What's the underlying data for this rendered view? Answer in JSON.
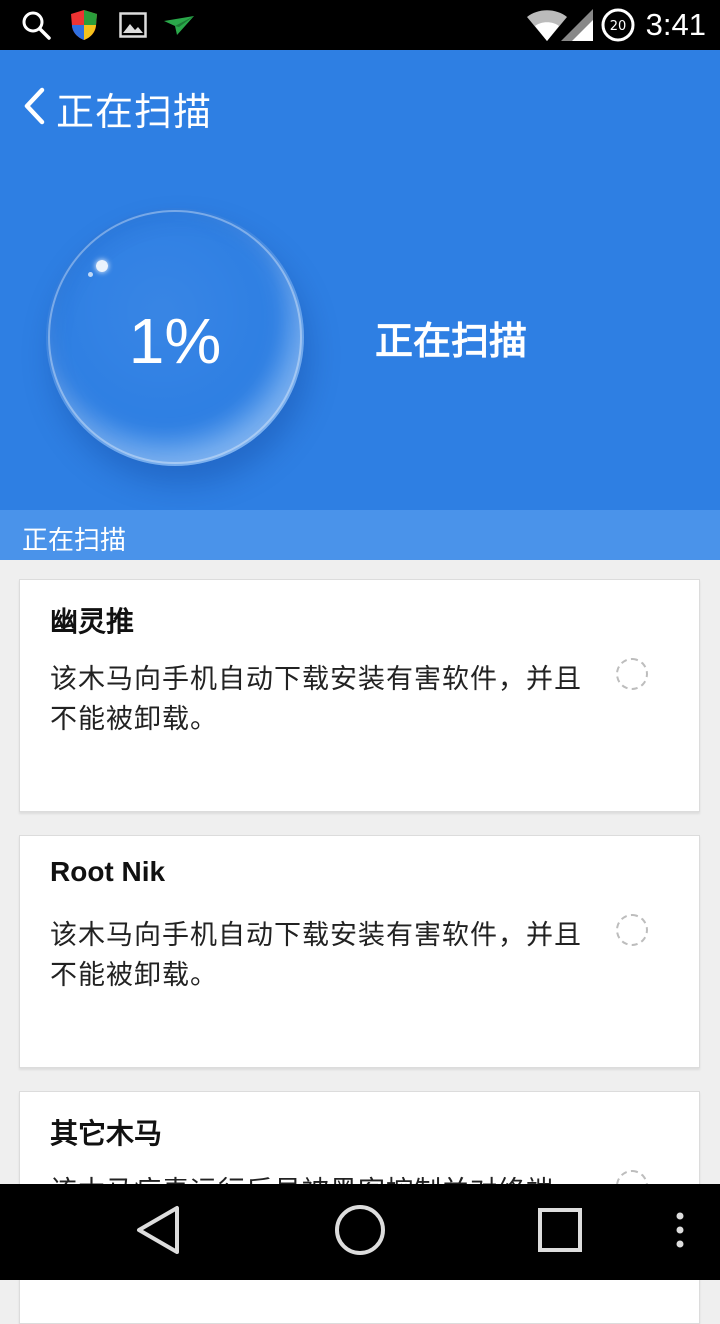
{
  "status_bar": {
    "time": "3:41",
    "notification_count": "20",
    "icons": [
      "search-icon",
      "shield-icon",
      "image-icon",
      "plane-icon",
      "wifi-icon",
      "signal-icon",
      "battery-icon"
    ]
  },
  "header": {
    "back_title": "正在扫描",
    "progress_text": "1%",
    "progress_percent": 1,
    "status_text": "正在扫描",
    "background_color": "#2e7fe3"
  },
  "sub_bar": {
    "label": "正在扫描"
  },
  "cards": [
    {
      "title": "幽灵推",
      "description": "该木马向手机自动下载安装有害软件，并且不能被卸载。"
    },
    {
      "title": "Root Nik",
      "description": "该木马向手机自动下载安装有害软件，并且不能被卸载。"
    },
    {
      "title": "其它木马",
      "description": "该木马病毒运行后易被黑客控制并对终端"
    }
  ],
  "nav_bar": {
    "icons": [
      "back-triangle-icon",
      "home-circle-icon",
      "recents-square-icon",
      "overflow-menu-icon"
    ]
  }
}
